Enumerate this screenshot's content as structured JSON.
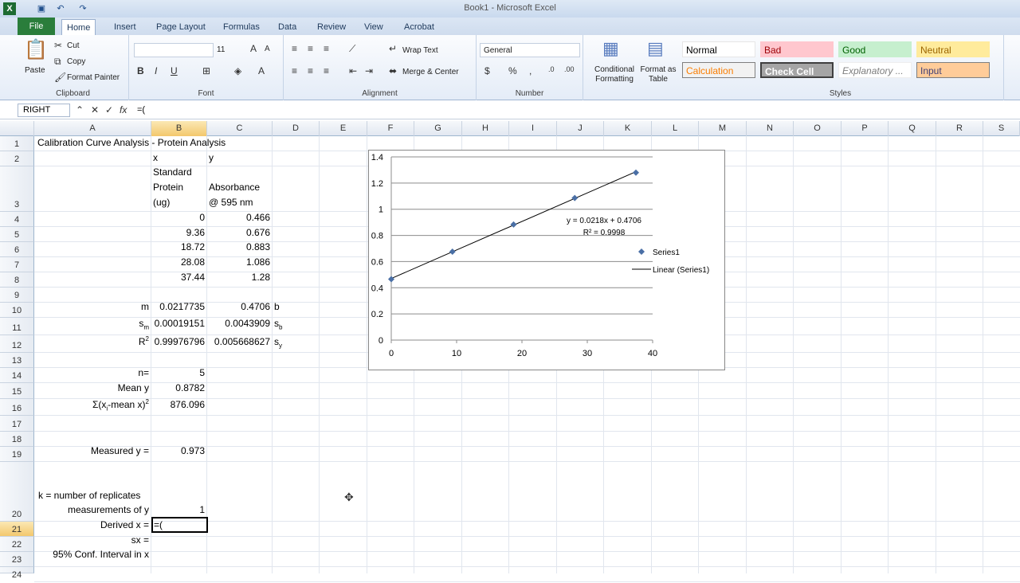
{
  "window": {
    "title": "Book1 - Microsoft Excel"
  },
  "tabs": [
    "File",
    "Home",
    "Insert",
    "Page Layout",
    "Formulas",
    "Data",
    "Review",
    "View",
    "Acrobat"
  ],
  "ribbon": {
    "clipboard": {
      "paste": "Paste",
      "cut": "Cut",
      "copy": "Copy",
      "format_painter": "Format Painter",
      "label": "Clipboard"
    },
    "font": {
      "size": "11",
      "label": "Font"
    },
    "alignment": {
      "wrap": "Wrap Text",
      "merge": "Merge & Center",
      "label": "Alignment"
    },
    "number": {
      "format": "General",
      "label": "Number"
    },
    "cond": "Conditional Formatting",
    "format_table": "Format as Table",
    "styles": {
      "normal": "Normal",
      "bad": "Bad",
      "good": "Good",
      "neutral": "Neutral",
      "calculation": "Calculation",
      "check_cell": "Check Cell",
      "explanatory": "Explanatory ...",
      "input": "Input",
      "label": "Styles"
    }
  },
  "formula_bar": {
    "name_box": "RIGHT",
    "formula": "=("
  },
  "columns": [
    "A",
    "B",
    "C",
    "D",
    "E",
    "F",
    "G",
    "H",
    "I",
    "J",
    "K",
    "L",
    "M",
    "N",
    "O",
    "P",
    "Q",
    "R",
    "S"
  ],
  "rows": [
    "1",
    "2",
    "3",
    "4",
    "5",
    "6",
    "7",
    "8",
    "9",
    "10",
    "11",
    "12",
    "13",
    "14",
    "15",
    "16",
    "17",
    "18",
    "19",
    "20",
    "21",
    "22",
    "23",
    "24"
  ],
  "cells": {
    "a1": "Calibration Curve Analysis - Protein Analysis",
    "b2": "x",
    "c2": "y",
    "b3a": "Standard",
    "b3b": "Protein",
    "b3c": "(ug)",
    "c3a": "Absorbance",
    "c3b": "@ 595 nm",
    "b4": "0",
    "c4": "0.466",
    "b5": "9.36",
    "c5": "0.676",
    "b6": "18.72",
    "c6": "0.883",
    "b7": "28.08",
    "c7": "1.086",
    "b8": "37.44",
    "c8": "1.28",
    "a10": "m",
    "b10": "0.0217735",
    "c10": "0.4706",
    "d10": "b",
    "a11": "sm",
    "b11": "0.00019151",
    "c11": "0.0043909",
    "d11": "sb",
    "a12": "R2",
    "b12": "0.99976796",
    "c12": "0.005668627",
    "d12": "sy",
    "a14": "n=",
    "b14": "5",
    "a15": "Mean y",
    "b15": "0.8782",
    "a16": "Σ(xi-mean x)2",
    "b16": "876.096",
    "a19": "Measured y =",
    "b19": "0.973",
    "a20a": "k = number of replicates",
    "a20b": "measurements of y",
    "b20": "1",
    "a21": "Derived x =",
    "b21": "=(",
    "a22": "sx =",
    "a23": "95% Conf. Interval in x"
  },
  "chart_data": {
    "type": "scatter",
    "x": [
      0,
      9.36,
      18.72,
      28.08,
      37.44
    ],
    "y": [
      0.466,
      0.676,
      0.883,
      1.086,
      1.28
    ],
    "trendline": {
      "slope": 0.0218,
      "intercept": 0.4706
    },
    "equation_label": "y = 0.0218x + 0.4706",
    "r2_label": "R² = 0.9998",
    "xlim": [
      0,
      40
    ],
    "ylim": [
      0,
      1.4
    ],
    "xticks": [
      "0",
      "10",
      "20",
      "30",
      "40"
    ],
    "yticks": [
      "0",
      "0.2",
      "0.4",
      "0.6",
      "0.8",
      "1",
      "1.2",
      "1.4"
    ],
    "legend": [
      "Series1",
      "Linear (Series1)"
    ],
    "legend_position": "right",
    "grid": "horizontal",
    "marker_color": "#4a6fa5"
  }
}
